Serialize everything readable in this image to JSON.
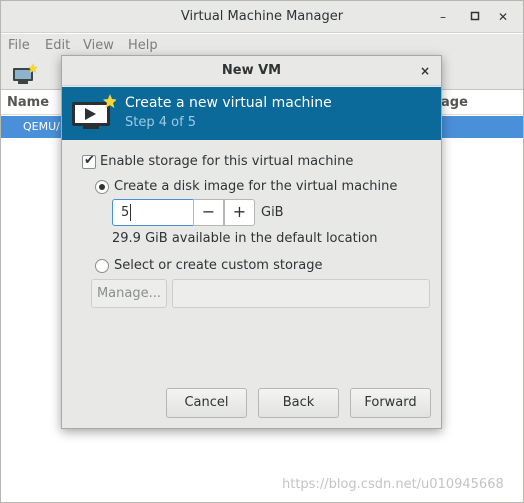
{
  "main_window": {
    "title": "Virtual Machine Manager",
    "controls": {
      "minimize": "–",
      "maximize": "▫",
      "close": "✕"
    },
    "menu": [
      "File",
      "Edit",
      "View",
      "Help"
    ],
    "list": {
      "columns": {
        "name": "Name",
        "usage_partial": "age"
      },
      "rows": [
        {
          "name": "QEMU/K"
        }
      ]
    }
  },
  "dialog": {
    "title": "New VM",
    "close": "×",
    "banner": {
      "title": "Create a new virtual machine",
      "step": "Step 4 of 5"
    },
    "enable_storage": {
      "label": "Enable storage for this virtual machine",
      "checked": true
    },
    "disk_image": {
      "label": "Create a disk image for the virtual machine",
      "selected": true,
      "size_value": "5",
      "unit": "GiB",
      "minus": "−",
      "plus": "+",
      "available": "29.9 GiB available in the default location"
    },
    "custom_storage": {
      "label": "Select or create custom storage",
      "selected": false,
      "manage_button": "Manage...",
      "path_value": ""
    },
    "buttons": {
      "cancel": "Cancel",
      "back": "Back",
      "forward": "Forward"
    }
  },
  "watermark": "https://blog.csdn.net/u010945668",
  "colors": {
    "banner": "#0b6a9a",
    "selection": "#4a90d9",
    "window_bg": "#e8e8e7"
  }
}
